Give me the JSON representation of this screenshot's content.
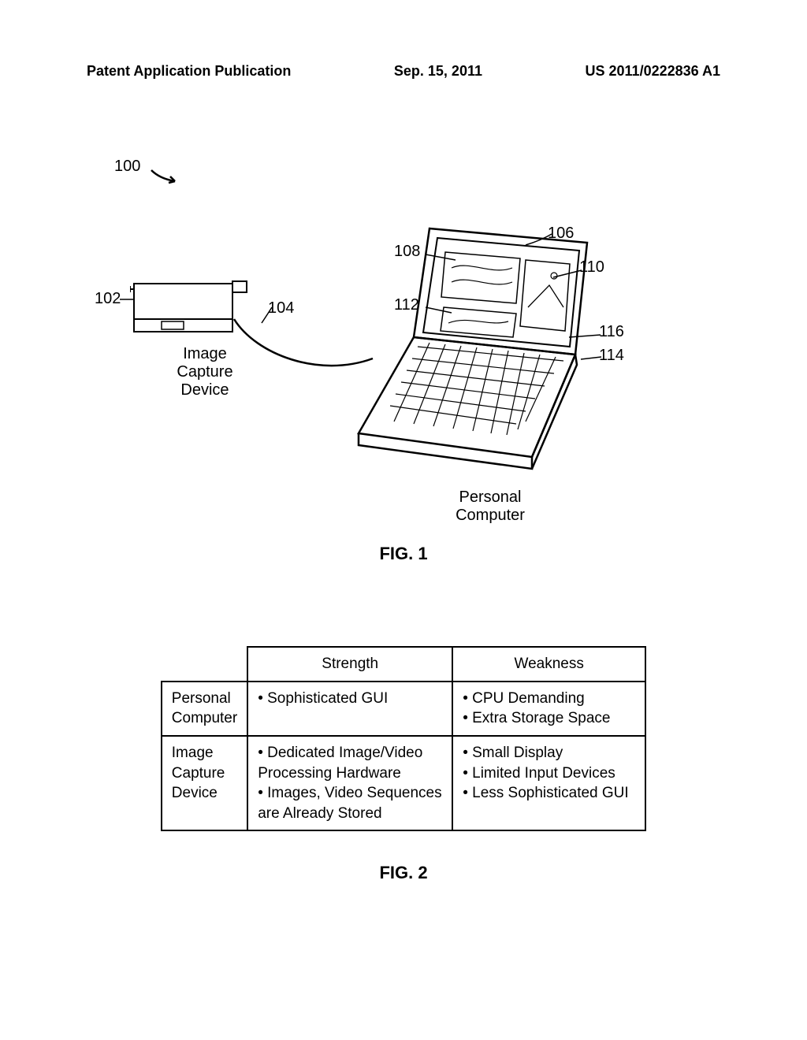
{
  "header": {
    "left": "Patent Application Publication",
    "center": "Sep. 15, 2011",
    "right": "US 2011/0222836 A1"
  },
  "fig1": {
    "ref_100": "100",
    "ref_102": "102",
    "ref_104": "104",
    "ref_106": "106",
    "ref_108": "108",
    "ref_110": "110",
    "ref_112": "112",
    "ref_114": "114",
    "ref_116": "116",
    "camera_label": "Image Capture Device",
    "pc_label": "Personal Computer",
    "caption": "FIG. 1"
  },
  "fig2": {
    "headers": {
      "strength": "Strength",
      "weakness": "Weakness"
    },
    "rows": [
      {
        "label": "Personal Computer",
        "strength": "• Sophisticated GUI",
        "weakness": "• CPU Demanding\n• Extra Storage Space"
      },
      {
        "label": "Image Capture Device",
        "strength": "• Dedicated Image/Video\n  Processing Hardware\n• Images, Video Sequences\n  are Already Stored",
        "weakness": "• Small Display\n• Limited Input Devices\n• Less Sophisticated GUI"
      }
    ],
    "caption": "FIG. 2"
  }
}
